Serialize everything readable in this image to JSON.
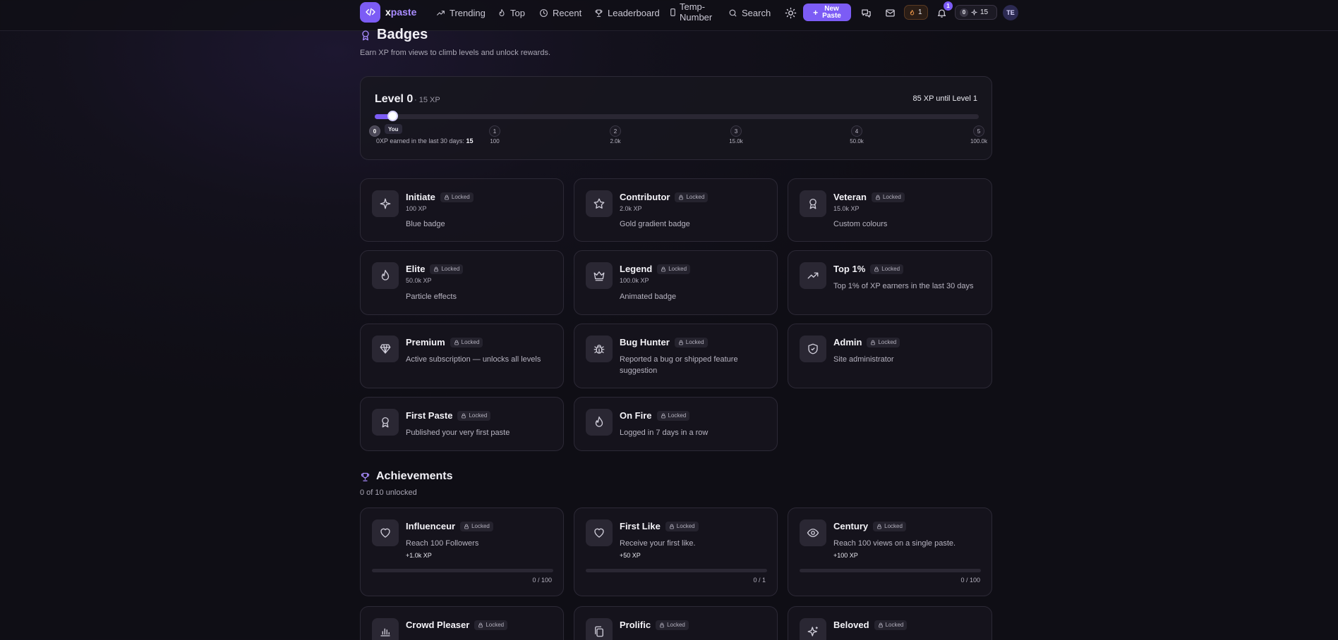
{
  "nav": {
    "logo_x": "x",
    "logo_paste": "paste",
    "items": [
      {
        "label": "Trending",
        "icon": "trending-icon"
      },
      {
        "label": "Top",
        "icon": "flame-icon"
      },
      {
        "label": "Recent",
        "icon": "clock-icon"
      },
      {
        "label": "Leaderboard",
        "icon": "trophy-icon"
      },
      {
        "label": "Temp-\nNumber",
        "icon": "phone-icon"
      },
      {
        "label": "Search",
        "icon": "search-icon"
      }
    ],
    "new_paste": "New\nPaste",
    "streak_count": "1",
    "notif_count": "1",
    "level_mini": "0",
    "xp_count": "15",
    "avatar": "TE"
  },
  "colors": {
    "accent": "#7c5cf5",
    "background": "#111018",
    "card": "#16141d"
  },
  "badges": {
    "title": "Badges",
    "subtitle": "Earn XP from views to climb levels and unlock rewards.",
    "level": {
      "title": "Level 0",
      "xp": "· 15 XP",
      "until": "85 XP until Level 1",
      "progress_fraction": 0.015,
      "you_label": "You",
      "earned_label": "XP earned in the last 30 days:",
      "earned_value": "15",
      "milestones": [
        {
          "num": "0",
          "val": "0"
        },
        {
          "num": "1",
          "val": "100"
        },
        {
          "num": "2",
          "val": "2.0k"
        },
        {
          "num": "3",
          "val": "15.0k"
        },
        {
          "num": "4",
          "val": "50.0k"
        },
        {
          "num": "5",
          "val": "100.0k"
        }
      ]
    },
    "lock_label": "Locked",
    "items": [
      {
        "name": "Initiate",
        "xp": "100 XP",
        "desc": "Blue badge",
        "icon": "sparkle-icon"
      },
      {
        "name": "Contributor",
        "xp": "2.0k XP",
        "desc": "Gold gradient badge",
        "icon": "star-icon"
      },
      {
        "name": "Veteran",
        "xp": "15.0k XP",
        "desc": "Custom colours",
        "icon": "award-icon"
      },
      {
        "name": "Elite",
        "xp": "50.0k XP",
        "desc": "Particle effects",
        "icon": "flame-icon"
      },
      {
        "name": "Legend",
        "xp": "100.0k XP",
        "desc": "Animated badge",
        "icon": "crown-icon"
      },
      {
        "name": "Top 1%",
        "xp": "",
        "desc": "Top 1% of XP earners in the last 30 days",
        "icon": "trending-icon"
      },
      {
        "name": "Premium",
        "xp": "",
        "desc": "Active subscription — unlocks all levels",
        "icon": "gem-icon"
      },
      {
        "name": "Bug Hunter",
        "xp": "",
        "desc": "Reported a bug or shipped feature suggestion",
        "icon": "bug-icon"
      },
      {
        "name": "Admin",
        "xp": "",
        "desc": "Site administrator",
        "icon": "shield-icon"
      },
      {
        "name": "First Paste",
        "xp": "",
        "desc": "Published your very first paste",
        "icon": "award-icon"
      },
      {
        "name": "On Fire",
        "xp": "",
        "desc": "Logged in 7 days in a row",
        "icon": "flame-icon"
      }
    ]
  },
  "achievements": {
    "title": "Achievements",
    "subtitle": "0 of 10 unlocked",
    "items": [
      {
        "name": "Influenceur",
        "desc": "Reach 100 Followers",
        "reward": "+1.0k XP",
        "progress": "0 / 100",
        "fraction": 0,
        "icon": "heart-icon"
      },
      {
        "name": "First Like",
        "desc": "Receive your first like.",
        "reward": "+50 XP",
        "progress": "0 / 1",
        "fraction": 0,
        "icon": "heart-icon"
      },
      {
        "name": "Century",
        "desc": "Reach 100 views on a single paste.",
        "reward": "+100 XP",
        "progress": "0 / 100",
        "fraction": 0,
        "icon": "eye-icon"
      },
      {
        "name": "Crowd Pleaser",
        "desc": "",
        "reward": "",
        "progress": "",
        "fraction": 0,
        "icon": "bar-chart-icon"
      },
      {
        "name": "Prolific",
        "desc": "",
        "reward": "",
        "progress": "",
        "fraction": 0,
        "icon": "files-icon"
      },
      {
        "name": "Beloved",
        "desc": "",
        "reward": "",
        "progress": "",
        "fraction": 0,
        "icon": "sparkle-icon"
      }
    ]
  }
}
